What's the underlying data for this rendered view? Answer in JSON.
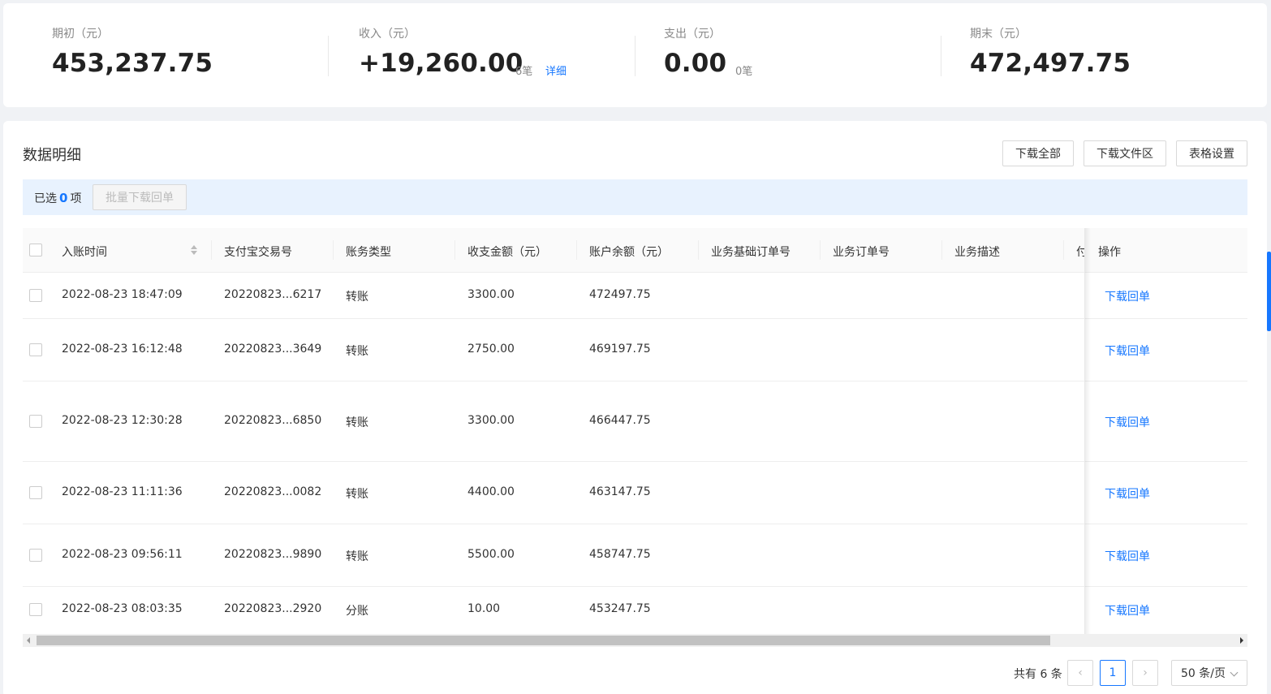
{
  "summary": {
    "opening": {
      "label": "期初（元）",
      "amount": "453,237.75"
    },
    "income": {
      "label": "收入（元）",
      "amount": "+19,260.00",
      "count": "6笔",
      "detail": "详细"
    },
    "expense": {
      "label": "支出（元）",
      "amount": "0.00",
      "count": "0笔"
    },
    "closing": {
      "label": "期末（元）",
      "amount": "472,497.75"
    }
  },
  "panel": {
    "title": "数据明细",
    "buttons": {
      "download_all": "下载全部",
      "download_area": "下载文件区",
      "table_settings": "表格设置"
    }
  },
  "selection": {
    "prefix": "已选",
    "count": "0",
    "suffix": "项",
    "batch_button": "批量下载回单"
  },
  "table": {
    "headers": {
      "time": "入账时间",
      "trade_no": "支付宝交易号",
      "type": "账务类型",
      "amount": "收支金额（元）",
      "balance": "账户余额（元）",
      "base_order": "业务基础订单号",
      "order": "业务订单号",
      "desc": "业务描述",
      "partial": "付",
      "action": "操作"
    },
    "rows": [
      {
        "time": "2022-08-23 18:47:09",
        "trade_no": "20220823...6217",
        "type": "转账",
        "amount": "3300.00",
        "balance": "472497.75",
        "action": "下载回单"
      },
      {
        "time": "2022-08-23 16:12:48",
        "trade_no": "20220823...3649",
        "type": "转账",
        "amount": "2750.00",
        "balance": "469197.75",
        "action": "下载回单"
      },
      {
        "time": "2022-08-23 12:30:28",
        "trade_no": "20220823...6850",
        "type": "转账",
        "amount": "3300.00",
        "balance": "466447.75",
        "action": "下载回单"
      },
      {
        "time": "2022-08-23 11:11:36",
        "trade_no": "20220823...0082",
        "type": "转账",
        "amount": "4400.00",
        "balance": "463147.75",
        "action": "下载回单"
      },
      {
        "time": "2022-08-23 09:56:11",
        "trade_no": "20220823...9890",
        "type": "转账",
        "amount": "5500.00",
        "balance": "458747.75",
        "action": "下载回单"
      },
      {
        "time": "2022-08-23 08:03:35",
        "trade_no": "20220823...2920",
        "type": "分账",
        "amount": "10.00",
        "balance": "453247.75",
        "action": "下载回单"
      }
    ]
  },
  "pagination": {
    "total": "共有 6 条",
    "prev": "‹",
    "current": "1",
    "next": "›",
    "page_size": "50 条/页"
  }
}
